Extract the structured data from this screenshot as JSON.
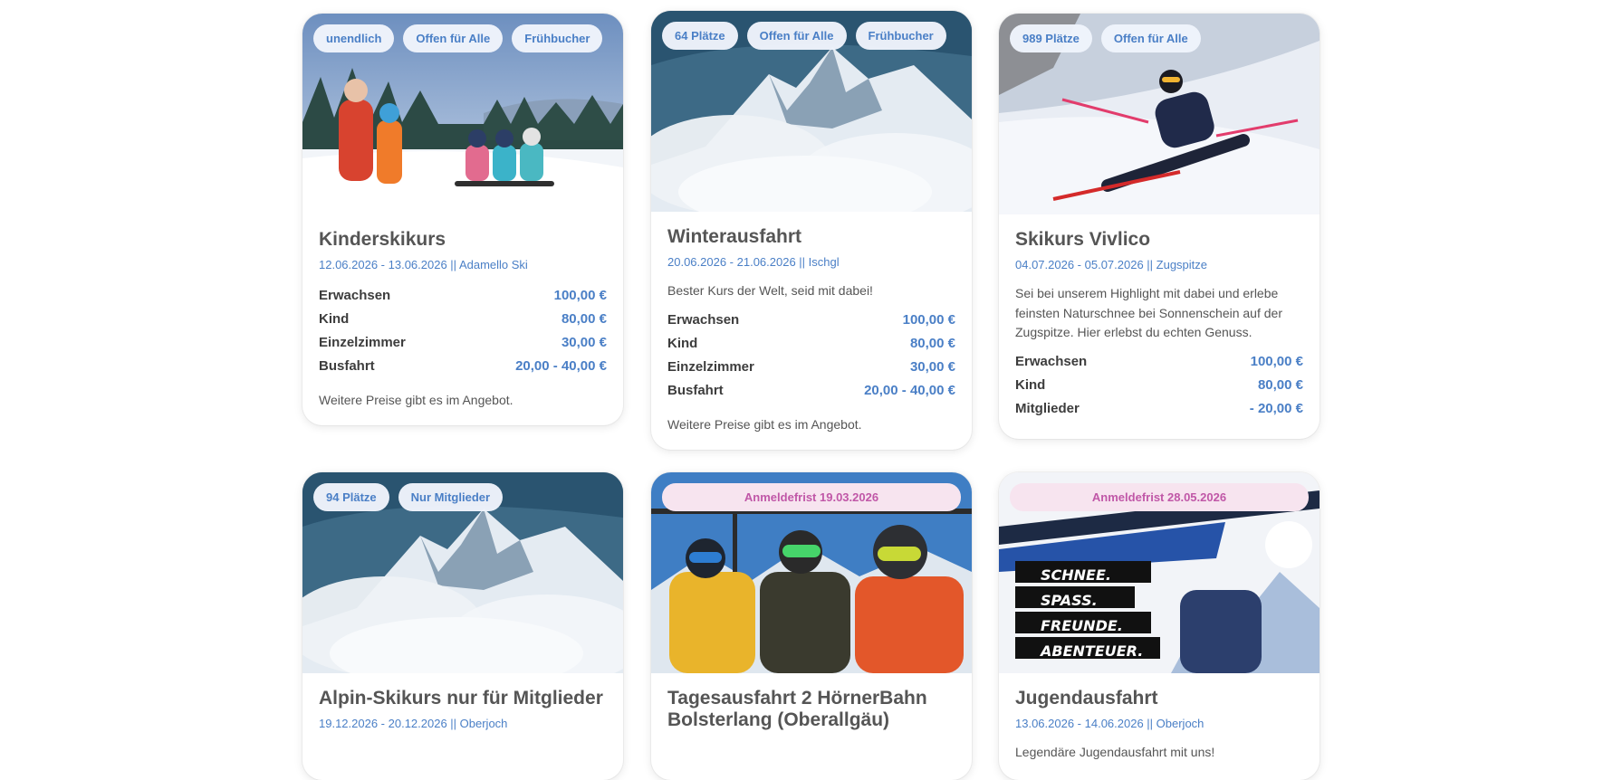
{
  "cards": [
    {
      "tags": [
        "unendlich",
        "Offen für Alle",
        "Frühbucher"
      ],
      "title": "Kinderskikurs",
      "meta": "12.06.2026 - 13.06.2026 || Adamello Ski",
      "prices": [
        {
          "label": "Erwachsen",
          "value": "100,00 €"
        },
        {
          "label": "Kind",
          "value": "80,00 €"
        },
        {
          "label": "Einzelzimmer",
          "value": "30,00 €"
        },
        {
          "label": "Busfahrt",
          "value": "20,00 - 40,00 €"
        }
      ],
      "note": "Weitere Preise gibt es im Angebot."
    },
    {
      "tags": [
        "64 Plätze",
        "Offen für Alle",
        "Frühbucher"
      ],
      "title": "Winterausfahrt",
      "meta": "20.06.2026 - 21.06.2026 || Ischgl",
      "desc": "Bester Kurs der Welt, seid mit dabei!",
      "prices": [
        {
          "label": "Erwachsen",
          "value": "100,00 €"
        },
        {
          "label": "Kind",
          "value": "80,00 €"
        },
        {
          "label": "Einzelzimmer",
          "value": "30,00 €"
        },
        {
          "label": "Busfahrt",
          "value": "20,00 - 40,00 €"
        }
      ],
      "note": "Weitere Preise gibt es im Angebot."
    },
    {
      "tags": [
        "989 Plätze",
        "Offen für Alle"
      ],
      "title": "Skikurs Vivlico",
      "meta": "04.07.2026 - 05.07.2026 || Zugspitze",
      "desc": "Sei bei unserem Highlight mit dabei und erlebe feinsten Naturschnee bei Sonnenschein auf der Zugspitze. Hier erlebst du echten Genuss.",
      "prices": [
        {
          "label": "Erwachsen",
          "value": "100,00 €"
        },
        {
          "label": "Kind",
          "value": "80,00 €"
        },
        {
          "label": "Mitglieder",
          "value": "- 20,00 €"
        }
      ]
    },
    {
      "tags": [
        "94 Plätze",
        "Nur Mitglieder"
      ],
      "title": "Alpin-Skikurs nur für Mitglieder",
      "meta": "19.12.2026 - 20.12.2026 || Oberjoch"
    },
    {
      "deadline": "Anmeldefrist 19.03.2026",
      "title": "Tagesausfahrt 2 HörnerBahn Bolsterlang (Oberallgäu)"
    },
    {
      "deadline": "Anmeldefrist 28.05.2026",
      "poster": [
        "SCHNEE.",
        "SPASS.",
        "FREUNDE.",
        "ABENTEUER."
      ],
      "title": "Jugendausfahrt",
      "meta": "13.06.2026 - 14.06.2026 || Oberjoch",
      "desc": "Legendäre Jugendausfahrt mit uns!"
    }
  ]
}
